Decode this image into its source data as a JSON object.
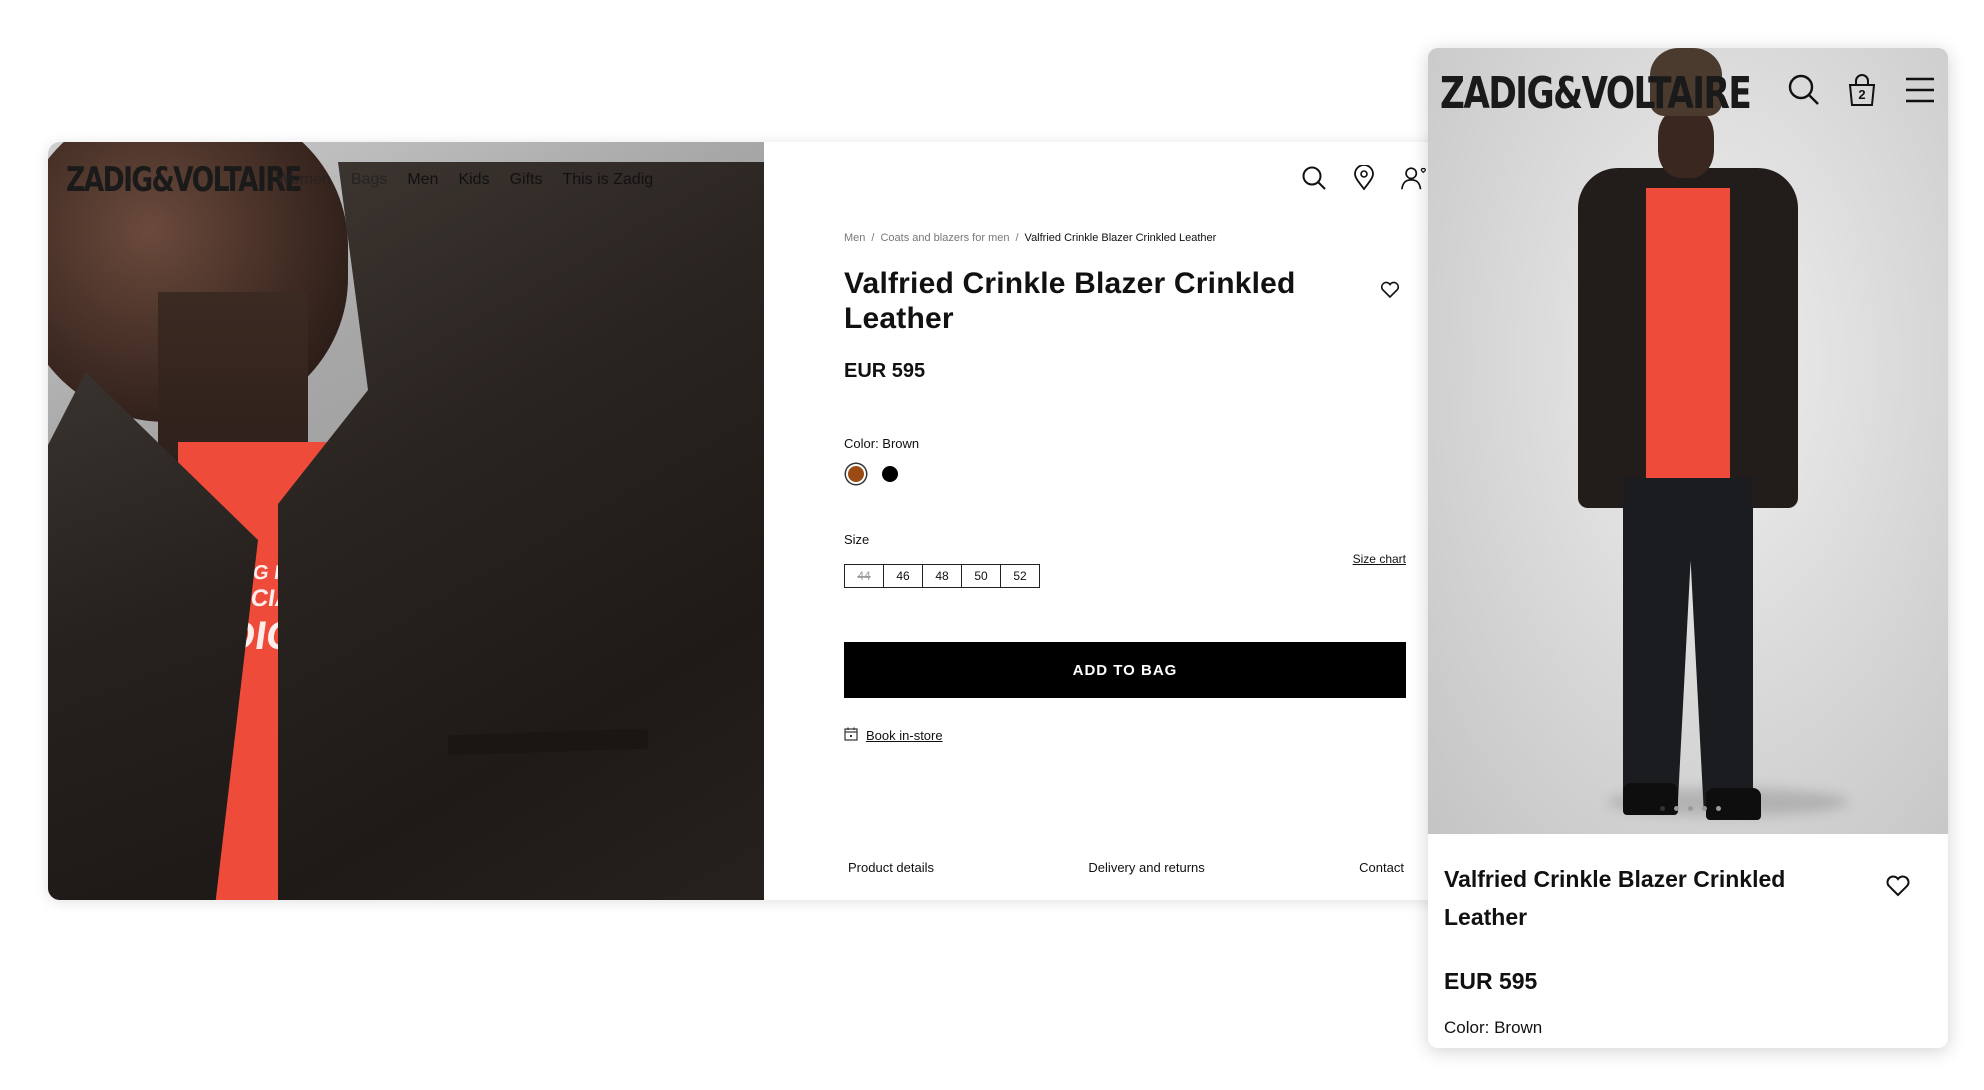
{
  "desktop": {
    "brand": "ZADIG&VOLTAIRE",
    "nav": [
      "Women",
      "Bags",
      "Men",
      "Kids",
      "Gifts",
      "This is Zadig"
    ],
    "hero_print": [
      "ZADIG PRE",
      "SPECIAL I",
      "ADIG & V"
    ],
    "breadcrumb": [
      "Men",
      "Coats and blazers for men",
      "Valfried Crinkle Blazer Crinkled Leather"
    ],
    "title": "Valfried Crinkle Blazer Crinkled Leather",
    "price": "EUR 595",
    "color_label": "Color: Brown",
    "colors": [
      {
        "name": "Brown",
        "hex": "#9a4a12",
        "selected": true
      },
      {
        "name": "Black",
        "hex": "#000000",
        "selected": false
      }
    ],
    "size_label": "Size",
    "size_chart": "Size chart",
    "sizes": [
      {
        "label": "44",
        "available": false
      },
      {
        "label": "46",
        "available": true
      },
      {
        "label": "48",
        "available": true
      },
      {
        "label": "50",
        "available": true
      },
      {
        "label": "52",
        "available": true
      }
    ],
    "add_to_bag": "ADD TO BAG",
    "book_in_store": "Book in-store",
    "tabs": [
      "Product details",
      "Delivery and returns",
      "Contact"
    ],
    "icons": [
      "search-icon",
      "store-locator-icon",
      "account-wishlist-icon",
      "heart-icon",
      "calendar-icon"
    ]
  },
  "mobile": {
    "brand": "ZADIG&VOLTAIRE",
    "bag_count": "2",
    "title": "Valfried Crinkle Blazer Crinkled Leather",
    "price": "EUR 595",
    "color_label": "Color: Brown",
    "carousel": {
      "count": 5,
      "active": 0
    },
    "icons": [
      "search-icon",
      "bag-icon",
      "menu-icon",
      "heart-icon"
    ]
  }
}
